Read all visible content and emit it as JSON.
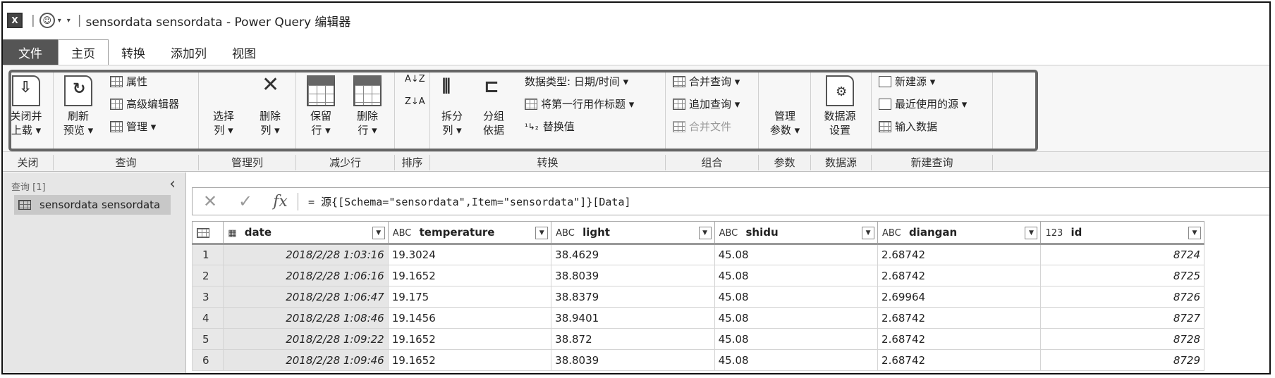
{
  "title": {
    "app_icon": "X",
    "text": "sensordata sensordata - Power Query 编辑器"
  },
  "menu": {
    "file": "文件",
    "tabs": [
      "主页",
      "转换",
      "添加列",
      "视图"
    ]
  },
  "ribbon": {
    "close_load": [
      "关闭并",
      "上载 ▾"
    ],
    "refresh": [
      "刷新",
      "预览 ▾"
    ],
    "properties": "属性",
    "advanced_editor": "高级编辑器",
    "manage": "管理 ▾",
    "choose_columns": [
      "选择",
      "列 ▾"
    ],
    "remove_columns": [
      "删除",
      "列 ▾"
    ],
    "keep_rows": [
      "保留",
      "行 ▾"
    ],
    "remove_rows": [
      "删除",
      "行 ▾"
    ],
    "split_column": [
      "拆分",
      "列 ▾"
    ],
    "group_by": [
      "分组",
      "依据"
    ],
    "data_type": "数据类型: 日期/时间 ▾",
    "first_row_header": "将第一行用作标题 ▾",
    "replace_values": "替换值",
    "merge_queries": "合并查询 ▾",
    "append_queries": "追加查询 ▾",
    "combine_files": "合并文件",
    "manage_params": [
      "管理",
      "参数 ▾"
    ],
    "datasource_settings": [
      "数据源",
      "设置"
    ],
    "new_source": "新建源 ▾",
    "recent_sources": "最近使用的源 ▾",
    "enter_data": "输入数据"
  },
  "group_labels": [
    "关闭",
    "查询",
    "管理列",
    "减少行",
    "排序",
    "转换",
    "组合",
    "参数",
    "数据源",
    "新建查询"
  ],
  "query_pane": {
    "header": "查询 [1]",
    "item": "sensordata sensordata"
  },
  "formula": {
    "cancel": "✕",
    "confirm": "✓",
    "fx": "fx",
    "text": "= 源{[Schema=\"sensordata\",Item=\"sensordata\"]}[Data]"
  },
  "columns": [
    {
      "type": "▦",
      "name": "date"
    },
    {
      "type": "ABC",
      "name": "temperature"
    },
    {
      "type": "ABC",
      "name": "light"
    },
    {
      "type": "ABC",
      "name": "shidu"
    },
    {
      "type": "ABC",
      "name": "diangan"
    },
    {
      "type": "123",
      "name": "id"
    }
  ],
  "rows": [
    [
      "1",
      "2018/2/28 1:03:16",
      "19.3024",
      "38.4629",
      "45.08",
      "2.68742",
      "8724"
    ],
    [
      "2",
      "2018/2/28 1:06:16",
      "19.1652",
      "38.8039",
      "45.08",
      "2.68742",
      "8725"
    ],
    [
      "3",
      "2018/2/28 1:06:47",
      "19.175",
      "38.8379",
      "45.08",
      "2.69964",
      "8726"
    ],
    [
      "4",
      "2018/2/28 1:08:46",
      "19.1456",
      "38.9401",
      "45.08",
      "2.68742",
      "8727"
    ],
    [
      "5",
      "2018/2/28 1:09:22",
      "19.1652",
      "38.872",
      "45.08",
      "2.68742",
      "8728"
    ],
    [
      "6",
      "2018/2/28 1:09:46",
      "19.1652",
      "38.8039",
      "45.08",
      "2.68742",
      "8729"
    ]
  ]
}
